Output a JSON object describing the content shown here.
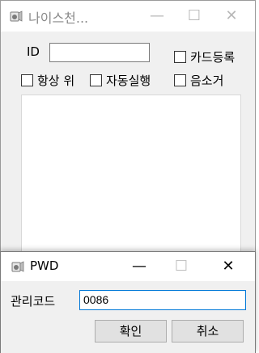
{
  "main_window": {
    "title": "나이스천...",
    "min_glyph": "—",
    "max_glyph": "☐",
    "close_glyph": "✕",
    "id_label": "ID",
    "id_value": "",
    "checkboxes": {
      "card_register": "카드등록",
      "always_on_top": "항상 위",
      "auto_run": "자동실행",
      "mute": "음소거"
    }
  },
  "dialog": {
    "title": "PWD",
    "min_glyph": "—",
    "max_glyph": "☐",
    "close_glyph": "✕",
    "code_label": "관리코드",
    "code_value": "0086",
    "ok_label": "확인",
    "cancel_label": "취소"
  },
  "colors": {
    "focus_border": "#0078d7",
    "window_bg": "#f0f0f0"
  }
}
